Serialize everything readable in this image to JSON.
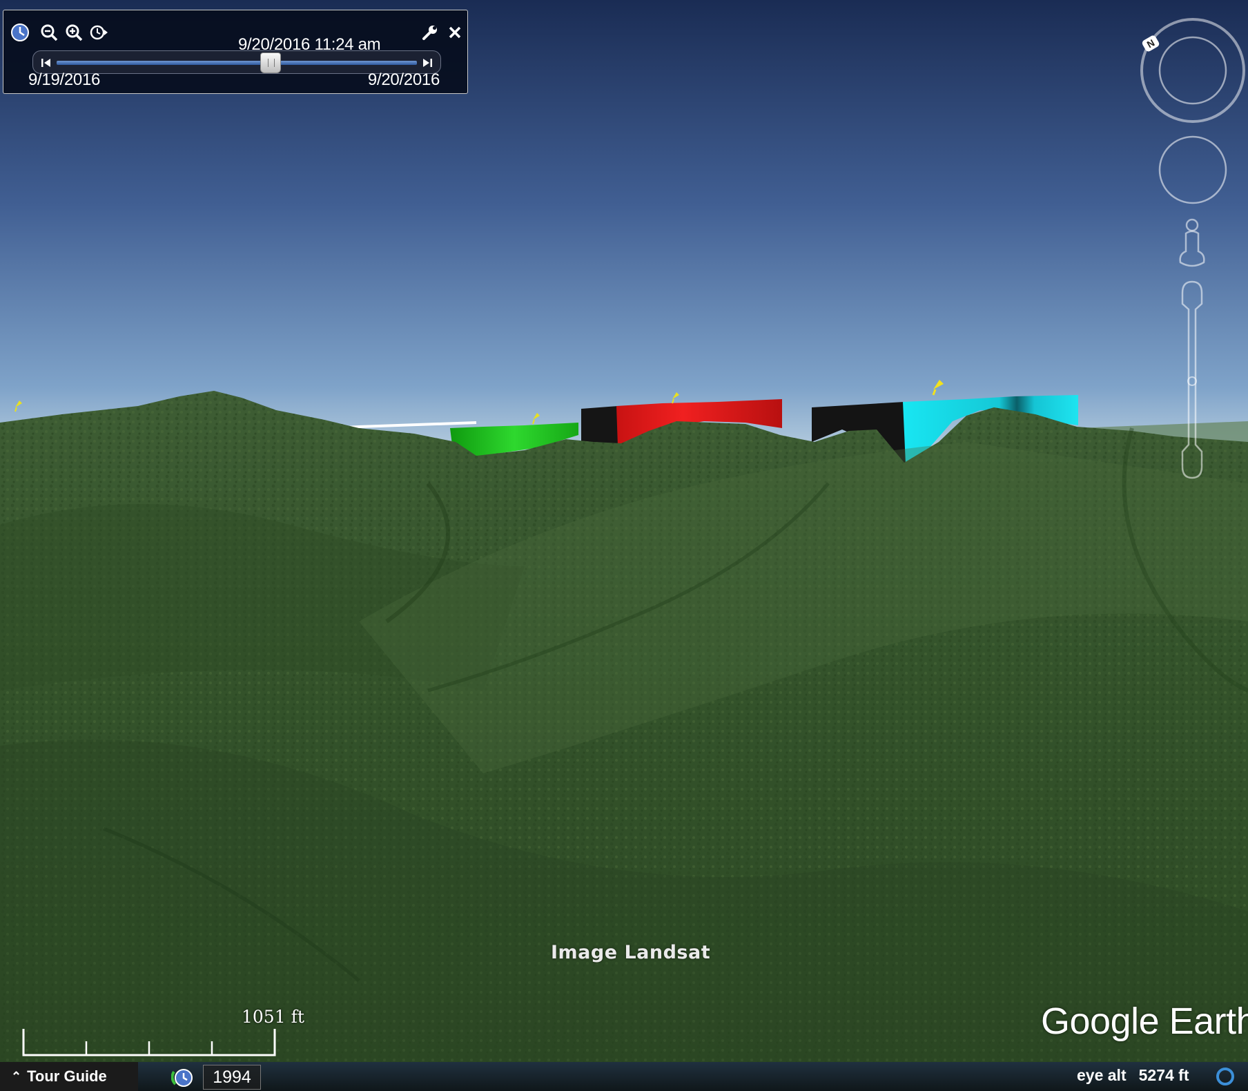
{
  "time_slider": {
    "current": "9/20/2016  11:24 am",
    "start": "9/19/2016",
    "end": "9/20/2016",
    "position": 0.6
  },
  "overlay": {
    "credit": "Image Landsat",
    "scale": "1051 ft",
    "logo": "Google Earth"
  },
  "status_bar": {
    "tour_guide": "Tour Guide",
    "year": "1994",
    "eye_alt_label": "eye alt",
    "eye_alt_value": "5274 ft"
  },
  "colors": {
    "track_green": "#1fc21f",
    "track_red": "#e31a1a",
    "track_cyan": "#18e0ee",
    "sky_top": "#1b2d55",
    "terrain": "#3a5a2a"
  },
  "icons": [
    "clock-icon",
    "zoom-out-icon",
    "zoom-in-icon",
    "history-icon",
    "wrench-icon",
    "close-icon",
    "north-icon",
    "placemark-icon",
    "pegman-icon"
  ]
}
